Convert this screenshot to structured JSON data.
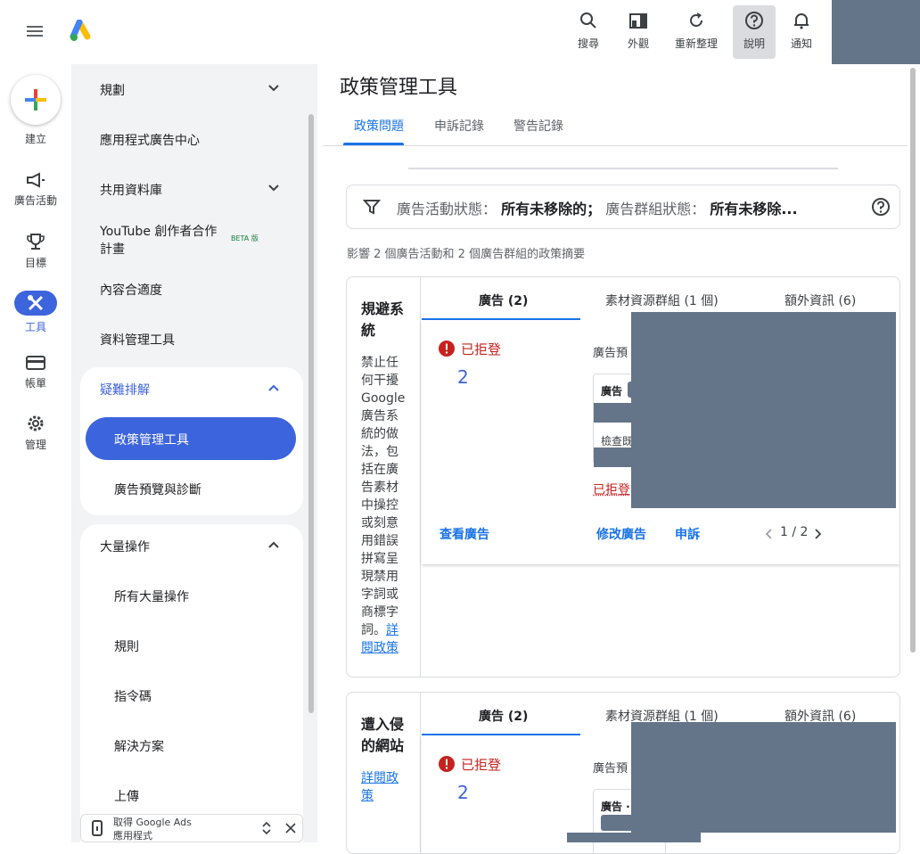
{
  "topbar": {
    "actions": [
      {
        "label": "搜尋",
        "icon": "search-icon"
      },
      {
        "label": "外觀",
        "icon": "appearance-icon"
      },
      {
        "label": "重新整理",
        "icon": "refresh-icon"
      },
      {
        "label": "說明",
        "icon": "help-icon"
      },
      {
        "label": "通知",
        "icon": "notification-bell-icon"
      }
    ]
  },
  "rail": {
    "create": "建立",
    "items": [
      {
        "label": "廣告活動",
        "icon": "megaphone-icon"
      },
      {
        "label": "目標",
        "icon": "trophy-icon"
      },
      {
        "label": "工具",
        "icon": "tools-icon"
      },
      {
        "label": "帳單",
        "icon": "credit-card-icon"
      },
      {
        "label": "管理",
        "icon": "gear-icon"
      }
    ]
  },
  "nav": {
    "items": {
      "planning": "規劃",
      "app_ads_hub": "應用程式廣告中心",
      "shared_library": "共用資料庫",
      "youtube_partner_1": "YouTube 創作者合作",
      "youtube_partner_2": "計畫",
      "beta": "BETA 版",
      "content_suitability": "內容合適度",
      "data_manager": "資料管理工具",
      "troubleshooting": "疑難排解",
      "policy_manager": "政策管理工具",
      "ad_preview": "廣告預覽與診斷",
      "bulk_actions": "大量操作",
      "all_bulk": "所有大量操作",
      "rules": "規則",
      "scripts": "指令碼",
      "solutions": "解決方案",
      "uploads": "上傳"
    },
    "promo": {
      "line1": "取得 Google Ads",
      "line2": "應用程式"
    }
  },
  "main": {
    "title": "政策管理工具",
    "tabs": [
      "政策問題",
      "申訴記錄",
      "警告記錄"
    ],
    "filter": {
      "campaign_label": "廣告活動狀態：",
      "campaign_value": "所有未移除的；",
      "adgroup_label": "廣告群組狀態：",
      "adgroup_value": "所有未移除..."
    },
    "summary": "影響 2 個廣告活動和 2 個廣告群組的政策摘要",
    "cards": [
      {
        "name": "規避系統",
        "desc": "禁止任何干擾Google廣告系統的做法，包括在廣告素材中操控或刻意用錯誤拼寫呈現禁用字詞或商標字詞。",
        "link": "詳閱政策",
        "tabs": [
          "廣告 (2)",
          "素材資源群組 (1 個)",
          "額外資訊 (6)"
        ],
        "status": "已拒登",
        "count": "2",
        "preview": "廣告預",
        "mini_title": "廣告",
        "mini_row": "檢查既",
        "rejected": "已拒登",
        "actions": {
          "view": "查看廣告",
          "edit": "修改廣告",
          "appeal": "申訴"
        },
        "pager": "1 / 2"
      },
      {
        "name": "遭入侵的網站",
        "link": "詳閱政策",
        "tabs": [
          "廣告 (2)",
          "素材資源群組 (1 個)",
          "額外資訊 (6)"
        ],
        "status": "已拒登",
        "count": "2",
        "preview": "廣告預",
        "mini_title": "廣告 ·"
      }
    ]
  }
}
